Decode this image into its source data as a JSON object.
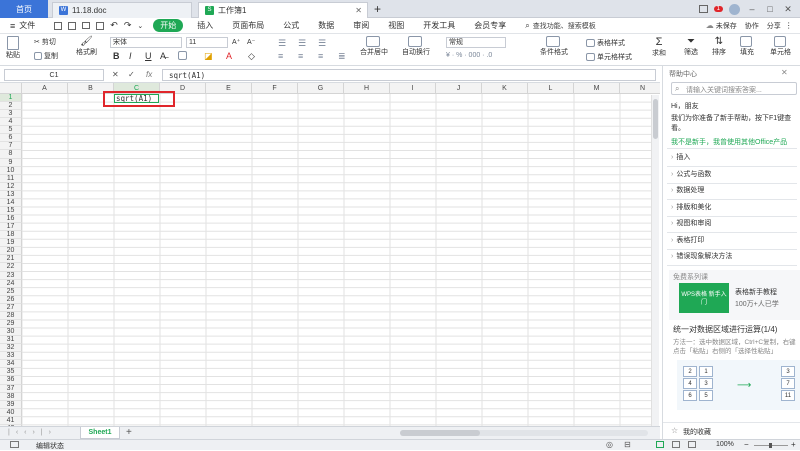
{
  "tabs": {
    "home": "首页",
    "doc": "11.18.doc",
    "book": "工作簿1",
    "add": "+"
  },
  "window": {
    "badge": "1",
    "min": "–",
    "max": "□",
    "close": "✕"
  },
  "menu": {
    "file": "文件",
    "start": "开始",
    "items": [
      "插入",
      "页面布局",
      "公式",
      "数据",
      "审阅",
      "视图",
      "开发工具",
      "会员专享"
    ],
    "search": "查找功能、搜索模板",
    "unsaved": "未保存",
    "collab": "协作",
    "share": "分享"
  },
  "ribbon": {
    "paste": "粘贴",
    "cut": "剪切",
    "copy": "复制",
    "painter": "格式刷",
    "font": "宋体",
    "size": "11",
    "bold": "B",
    "italic": "I",
    "underline": "U",
    "merge": "合并居中",
    "wrap": "自动换行",
    "numfmt": "常规",
    "cond": "条件格式",
    "tablestyle": "表格样式",
    "cellstyle": "单元格样式",
    "sum": "求和",
    "filter": "筛选",
    "sort": "排序",
    "fill": "填充",
    "cellfmt": "单元格"
  },
  "formula": {
    "namebox": "C1",
    "cancel": "✕",
    "confirm": "✓",
    "fx": "fx",
    "content": "sqrt(A1)"
  },
  "grid": {
    "columns": [
      "A",
      "B",
      "C",
      "D",
      "E",
      "F",
      "G",
      "H",
      "I",
      "J",
      "K",
      "L",
      "M",
      "N"
    ],
    "rows": [
      "1",
      "2",
      "3",
      "4",
      "5",
      "6",
      "7",
      "8",
      "9",
      "10",
      "11",
      "12",
      "13",
      "14",
      "15",
      "16",
      "17",
      "18",
      "19",
      "20",
      "21",
      "22",
      "23",
      "24",
      "25",
      "26",
      "27",
      "28",
      "29",
      "30",
      "31",
      "32",
      "33",
      "34",
      "35",
      "36",
      "37",
      "38",
      "39",
      "40",
      "41",
      "42"
    ],
    "active_cell_text": "sqrt(A1)"
  },
  "sheet": {
    "name": "Sheet1",
    "add": "+"
  },
  "status": {
    "mode": "编辑状态",
    "zoom": "100%",
    "zoom_minus": "−",
    "zoom_plus": "+"
  },
  "help": {
    "title": "帮助中心",
    "search_placeholder": "请输入关键词搜索答案...",
    "greeting": "Hi，朋友",
    "intro": "我们为你准备了新手帮助，按下F1键查看。",
    "link": "我不是新手，我曾使用其他Office产品",
    "categories": [
      "插入",
      "公式与函数",
      "数据处理",
      "排版和美化",
      "视图和审阅",
      "表格打印",
      "错误现象解决方法"
    ],
    "course_label": "免费系列课",
    "course_thumb": "WPS表格 新手入门",
    "course_title": "表格新手教程",
    "course_sub": "100万+人已学",
    "card_title": "统一对数据区域进行运算(1/4)",
    "card_text": "方法一：选中数据区域，Ctrl+C复制，右键点击「粘贴」右侧的「选择性粘贴」",
    "demo_left": [
      "2",
      "4",
      "6"
    ],
    "demo_mid": [
      "1",
      "3",
      "5"
    ],
    "demo_right": [
      "3",
      "7",
      "11"
    ],
    "favorites": "我的收藏"
  },
  "colors": {
    "accent": "#3b74d8",
    "start_green": "#1fa855",
    "selection_red": "#e0262b"
  }
}
